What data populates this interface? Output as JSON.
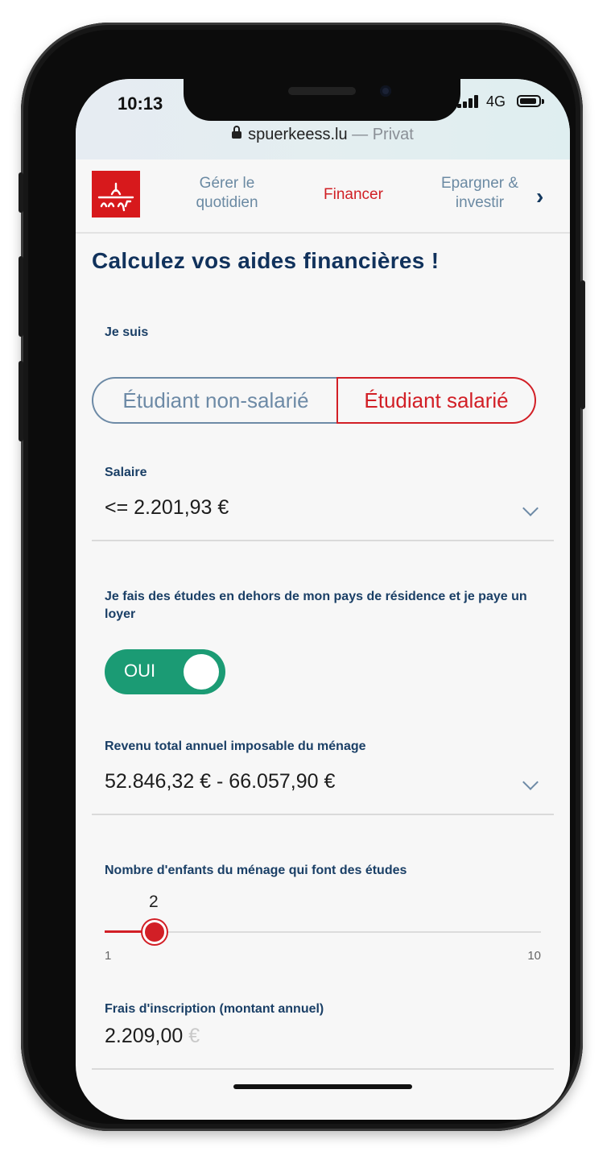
{
  "status": {
    "time": "10:13",
    "network": "4G"
  },
  "browser": {
    "url": "spuerkeess.lu",
    "mode": "— Privat"
  },
  "nav": {
    "items": [
      {
        "label_line1": "Gérer le",
        "label_line2": "quotidien"
      },
      {
        "label": "Financer"
      },
      {
        "label_line1": "Epargner &",
        "label_line2": "investir"
      }
    ]
  },
  "page": {
    "title": "Calculez vos aides financières !"
  },
  "form": {
    "status_label": "Je suis",
    "status_options": [
      "Étudiant non-salarié",
      "Étudiant salarié"
    ],
    "status_selected": "Étudiant salarié",
    "salary": {
      "label": "Salaire",
      "value": "<= 2.201,93 €"
    },
    "abroad": {
      "label": "Je fais des études en dehors de mon pays de résidence et je paye un loyer",
      "toggle_text": "OUI",
      "toggle_on": true
    },
    "household_income": {
      "label": "Revenu total annuel imposable du ménage",
      "value": "52.846,32 € - 66.057,90 €"
    },
    "children": {
      "label": "Nombre d'enfants du ménage qui font des études",
      "value": "2",
      "min": "1",
      "max": "10"
    },
    "fees": {
      "label": "Frais d'inscription (montant annuel)",
      "value": "2.209,00",
      "currency": "€"
    }
  },
  "colors": {
    "accent_red": "#d21f26",
    "brand_navy": "#11325c",
    "toggle_green": "#1b9b74",
    "secondary_blue": "#6d8aa6"
  }
}
